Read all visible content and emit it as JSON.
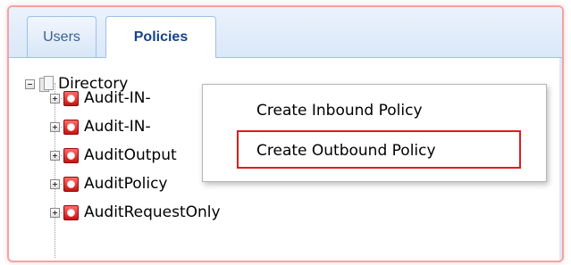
{
  "tabs": [
    {
      "label": "Users",
      "active": false
    },
    {
      "label": "Policies",
      "active": true
    }
  ],
  "tree": {
    "root": {
      "label": "Directory",
      "icon": "directory-icon",
      "expanded": true
    },
    "items": [
      {
        "label": "Audit-IN-",
        "icon": "policy-icon"
      },
      {
        "label": "Audit-IN-",
        "icon": "policy-icon"
      },
      {
        "label": "AuditOutput",
        "icon": "policy-icon"
      },
      {
        "label": "AuditPolicy",
        "icon": "policy-icon"
      },
      {
        "label": "AuditRequestOnly",
        "icon": "policy-icon"
      }
    ]
  },
  "context_menu": {
    "items": [
      {
        "label": "Create Inbound Policy"
      },
      {
        "label": "Create Outbound Policy",
        "highlighted": true
      }
    ]
  },
  "colors": {
    "highlight_border": "#e01b1b",
    "frame_border": "#f3a3a3",
    "tab_active_text": "#15428b",
    "policy_icon": "#d91c1c"
  }
}
